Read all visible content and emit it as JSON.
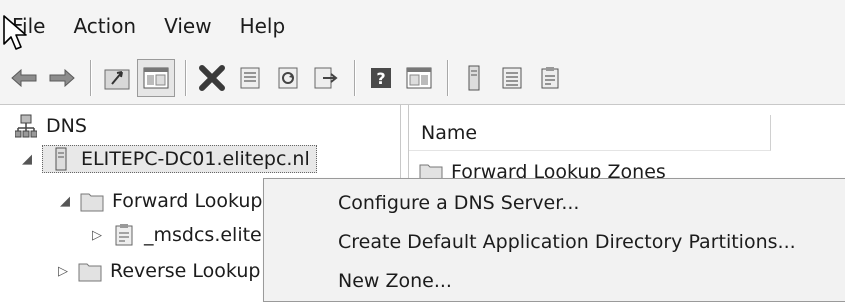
{
  "menubar": {
    "items": [
      {
        "label": "File"
      },
      {
        "label": "Action"
      },
      {
        "label": "View"
      },
      {
        "label": "Help"
      }
    ]
  },
  "toolbar": {
    "buttons": [
      "back-icon",
      "forward-icon",
      "up-folder-icon",
      "show-hide-tree-icon",
      "delete-icon",
      "properties-icon",
      "refresh-icon",
      "export-list-icon",
      "help-icon",
      "show-hide-action-pane-icon",
      "server-icon",
      "zone-icon",
      "record-icon"
    ]
  },
  "tree": {
    "root": {
      "label": "DNS"
    },
    "server": {
      "label": "ELITEPC-DC01.elitepc.nl"
    },
    "forward": {
      "label": "Forward Lookup Zones"
    },
    "msdcs": {
      "label": "_msdcs.elitepc.nl"
    },
    "reverse": {
      "label": "Reverse Lookup Zones"
    }
  },
  "list": {
    "column_header": "Name",
    "rows": [
      {
        "label": "Forward Lookup Zones"
      }
    ]
  },
  "context_menu": {
    "items": [
      {
        "label": "Configure a DNS Server..."
      },
      {
        "label": "Create Default Application Directory Partitions..."
      },
      {
        "label": "New Zone..."
      }
    ]
  }
}
